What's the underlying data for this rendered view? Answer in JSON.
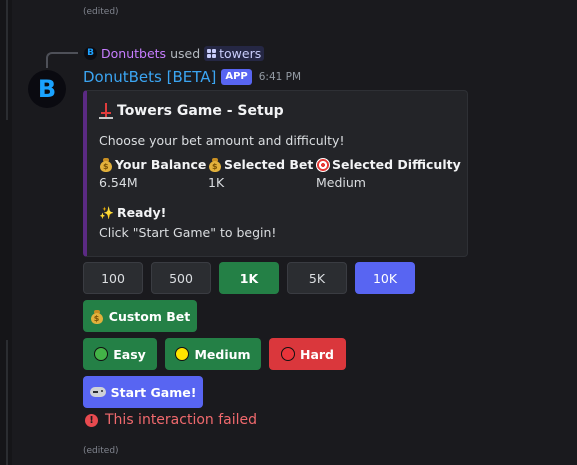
{
  "message": {
    "edited_top": "(edited)",
    "edited_bottom": "(edited)",
    "used_by": "Donutbets",
    "used_word": "used",
    "command": "towers",
    "bot_name": "DonutBets [BETA]",
    "app_tag": "APP",
    "timestamp": "6:41 PM",
    "avatar_letter": "B"
  },
  "embed": {
    "accent_color": "#5b2a83",
    "title": "Towers Game - Setup",
    "description": "Choose your bet amount and difficulty!",
    "fields": [
      {
        "name": "Your Balance",
        "value": "6.54M",
        "icon": "money-bag-icon"
      },
      {
        "name": "Selected Bet",
        "value": "1K",
        "icon": "money-bag-icon"
      },
      {
        "name": "Selected Difficulty",
        "value": "Medium",
        "icon": "target-icon"
      }
    ],
    "ready_title": "Ready!",
    "ready_desc": "Click \"Start Game\" to begin!"
  },
  "bet_buttons": [
    {
      "label": "100",
      "style": "grey"
    },
    {
      "label": "500",
      "style": "grey"
    },
    {
      "label": "1K",
      "style": "green"
    },
    {
      "label": "5K",
      "style": "grey"
    },
    {
      "label": "10K",
      "style": "blurple"
    }
  ],
  "custom_bet_label": "Custom Bet",
  "difficulty_buttons": [
    {
      "label": "Easy",
      "icon": "green-circle-icon"
    },
    {
      "label": "Medium",
      "icon": "yellow-circle-icon"
    },
    {
      "label": "Hard",
      "icon": "red-circle-icon"
    }
  ],
  "start_label": "Start Game!",
  "error_text": "This interaction failed",
  "colors": {
    "green": "#248046",
    "blurple": "#5865f2",
    "red": "#da373c",
    "grey": "#2b2d31",
    "error": "#f0696d"
  }
}
